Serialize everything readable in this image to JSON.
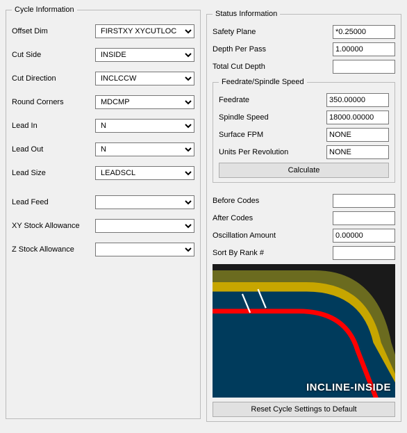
{
  "cycle": {
    "legend": "Cycle Information",
    "fields": {
      "offset_dim": {
        "label": "Offset Dim",
        "value": "FIRSTXY XYCUTLOC"
      },
      "cut_side": {
        "label": "Cut Side",
        "value": "INSIDE"
      },
      "cut_dir": {
        "label": "Cut Direction",
        "value": "INCLCCW"
      },
      "round": {
        "label": "Round Corners",
        "value": "MDCMP"
      },
      "lead_in": {
        "label": "Lead In",
        "value": "N"
      },
      "lead_out": {
        "label": "Lead Out",
        "value": "N"
      },
      "lead_size": {
        "label": "Lead Size",
        "value": "LEADSCL"
      },
      "lead_feed": {
        "label": "Lead Feed",
        "value": ""
      },
      "xy_stock": {
        "label": "XY Stock Allowance",
        "value": ""
      },
      "z_stock": {
        "label": "Z Stock Allowance",
        "value": ""
      }
    }
  },
  "status": {
    "legend": "Status Information",
    "safety_plane": {
      "label": "Safety Plane",
      "value": "*0.25000"
    },
    "depth_per_pass": {
      "label": "Depth Per Pass",
      "value": "1.00000"
    },
    "total_depth": {
      "label": "Total Cut Depth",
      "value": ""
    },
    "feed_group": {
      "legend": "Feedrate/Spindle Speed",
      "feedrate": {
        "label": "Feedrate",
        "value": "350.00000"
      },
      "spindle": {
        "label": "Spindle Speed",
        "value": "18000.00000"
      },
      "sfpm": {
        "label": "Surface FPM",
        "value": "NONE"
      },
      "upr": {
        "label": "Units Per Revolution",
        "value": "NONE"
      },
      "calc": {
        "label": "Calculate"
      }
    },
    "before_codes": {
      "label": "Before Codes",
      "value": ""
    },
    "after_codes": {
      "label": "After Codes",
      "value": ""
    },
    "osc_amt": {
      "label": "Oscillation Amount",
      "value": "0.00000"
    },
    "sort_rank": {
      "label": "Sort By Rank #",
      "value": ""
    },
    "image_caption": "INCLINE-INSIDE",
    "reset": {
      "label": "Reset Cycle Settings to Default"
    }
  }
}
